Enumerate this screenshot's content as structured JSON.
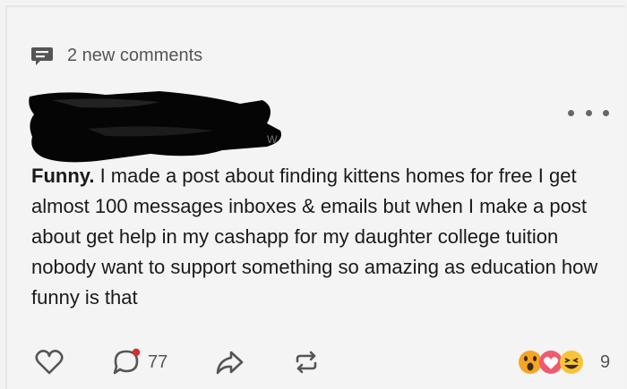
{
  "header": {
    "new_comments_label": "2 new comments"
  },
  "post": {
    "lead": "Funny.",
    "body": " I made a post about finding kittens homes for free I get almost 100 messages inboxes & emails but when I make a post about get help in my cashapp for my daughter college tuition nobody want to support something so amazing as education how funny is that"
  },
  "actions": {
    "comment_count": "77",
    "reaction_count": "9"
  },
  "icons": {
    "new_comments": "comment-bubble-icon",
    "like": "heart-icon",
    "comment": "comment-icon",
    "share": "share-arrow-icon",
    "repost": "repost-icon",
    "more": "more-dots-icon"
  },
  "colors": {
    "background": "#f4f4f4",
    "text": "#1a1a1a",
    "muted": "#555555",
    "notification_dot": "#d62d2d"
  }
}
